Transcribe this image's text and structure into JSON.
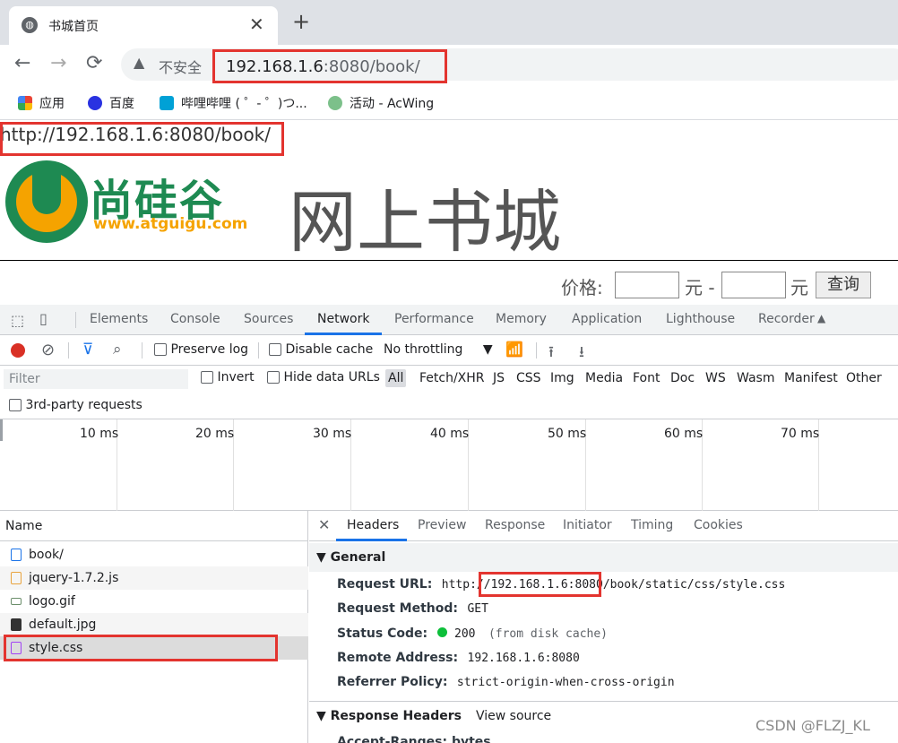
{
  "browser": {
    "tab_title": "书城首页",
    "tab_close": "✕",
    "new_tab": "+",
    "nav_back": "←",
    "nav_forward": "→",
    "nav_reload": "⟳",
    "security_label": "不安全",
    "url_host": "192.168.1.6",
    "url_rest": ":8080/book/",
    "bookmarks": [
      "应用",
      "百度",
      "哔哩哔哩 ( ゜- ゜)つ...",
      "活动 - AcWing"
    ]
  },
  "page": {
    "url_text": "http://192.168.1.6:8080/book/",
    "logo_cn": "尚硅谷",
    "logo_en": "www.atguigu.com",
    "title": "网上书城",
    "price_label": "价格:",
    "yuan1": "元 -",
    "yuan2": "元",
    "query_button": "查询"
  },
  "devtools": {
    "tabs": [
      "Elements",
      "Console",
      "Sources",
      "Network",
      "Performance",
      "Memory",
      "Application",
      "Lighthouse",
      "Recorder"
    ],
    "active_tab": "Network",
    "toolbar": {
      "preserve_log": "Preserve log",
      "disable_cache": "Disable cache",
      "throttling": "No throttling"
    },
    "filter": {
      "placeholder": "Filter",
      "invert": "Invert",
      "hide_data_urls": "Hide data URLs",
      "types": [
        "All",
        "Fetch/XHR",
        "JS",
        "CSS",
        "Img",
        "Media",
        "Font",
        "Doc",
        "WS",
        "Wasm",
        "Manifest",
        "Other"
      ],
      "third_party": "3rd-party requests"
    },
    "timeline_labels": [
      "10 ms",
      "20 ms",
      "30 ms",
      "40 ms",
      "50 ms",
      "60 ms",
      "70 ms"
    ],
    "name_header": "Name",
    "requests": [
      "book/",
      "jquery-1.7.2.js",
      "logo.gif",
      "default.jpg",
      "style.css"
    ],
    "detail_tabs": [
      "Headers",
      "Preview",
      "Response",
      "Initiator",
      "Timing",
      "Cookies"
    ],
    "general_title": "General",
    "general": {
      "request_url_label": "Request URL:",
      "request_url_prefix": "http://",
      "request_url_host": "192.168.1.6:8080",
      "request_url_path": "/book/static/css/style.css",
      "method_label": "Request Method:",
      "method_value": "GET",
      "status_label": "Status Code:",
      "status_value": "200",
      "status_note": "(from disk cache)",
      "remote_label": "Remote Address:",
      "remote_value": "192.168.1.6:8080",
      "referrer_label": "Referrer Policy:",
      "referrer_value": "strict-origin-when-cross-origin"
    },
    "response_headers_title": "Response Headers",
    "view_source": "View source",
    "partial_row": "Accept-Ranges: bytes"
  },
  "watermark": "CSDN @FLZJ_KL",
  "colors": {
    "highlight": "#e3342f",
    "accent": "#1a73e8",
    "brand_green": "#1e8a52",
    "brand_orange": "#f5a300"
  }
}
